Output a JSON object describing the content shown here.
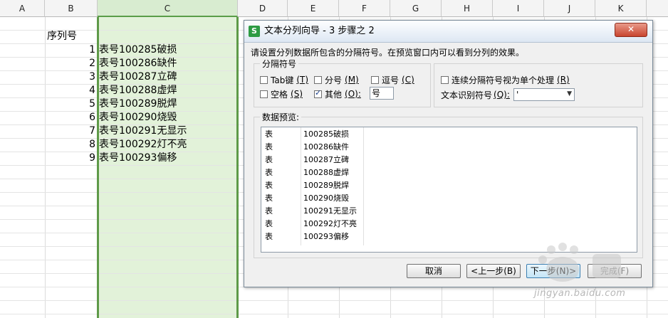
{
  "sheet": {
    "columns": [
      "A",
      "B",
      "C",
      "D",
      "E",
      "F",
      "G",
      "H",
      "I",
      "J",
      "K"
    ],
    "header_cell": "序列号",
    "rows": [
      {
        "n": "1",
        "text": "表号100285破损"
      },
      {
        "n": "2",
        "text": "表号100286缺件"
      },
      {
        "n": "3",
        "text": "表号100287立碑"
      },
      {
        "n": "4",
        "text": "表号100288虚焊"
      },
      {
        "n": "5",
        "text": "表号100289脱焊"
      },
      {
        "n": "6",
        "text": "表号100290烧毁"
      },
      {
        "n": "7",
        "text": "表号100291无显示"
      },
      {
        "n": "8",
        "text": "表号100292灯不亮"
      },
      {
        "n": "9",
        "text": "表号100293偏移"
      }
    ],
    "selected_column": "C",
    "accent": "#5e9a48"
  },
  "dialog": {
    "icon": "S",
    "title": "文本分列向导 - 3 步骤之 2",
    "close": "✕",
    "instruction": "请设置分列数据所包含的分隔符号。在预览窗口内可以看到分列的效果。",
    "delimiters": {
      "group_title": "分隔符号",
      "tab": {
        "label": "Tab键",
        "key": "(T)",
        "checked": false
      },
      "semicolon": {
        "label": "分号",
        "key": "(M)",
        "checked": false
      },
      "comma": {
        "label": "逗号",
        "key": "(C)",
        "checked": false
      },
      "space": {
        "label": "空格",
        "key": "(S)",
        "checked": false
      },
      "other": {
        "label": "其他",
        "key": "(O):",
        "checked": true,
        "value": "号"
      }
    },
    "consecutive": {
      "label": "连续分隔符号视为单个处理",
      "key": "(R)",
      "checked": false
    },
    "qualifier": {
      "label": "文本识别符号",
      "key": "(Q):",
      "value": "'"
    },
    "preview": {
      "title": "数据预览:",
      "rows": [
        [
          "表",
          "100285破损"
        ],
        [
          "表",
          "100286缺件"
        ],
        [
          "表",
          "100287立碑"
        ],
        [
          "表",
          "100288虚焊"
        ],
        [
          "表",
          "100289脱焊"
        ],
        [
          "表",
          "100290烧毁"
        ],
        [
          "表",
          "100291无显示"
        ],
        [
          "表",
          "100292灯不亮"
        ],
        [
          "表",
          "100293偏移"
        ]
      ]
    },
    "buttons": {
      "cancel": "取消",
      "back": "<上一步(B)",
      "next": "下一步(N)>",
      "finish": "完成(F)"
    }
  },
  "watermark": "jingyan.baidu.com"
}
